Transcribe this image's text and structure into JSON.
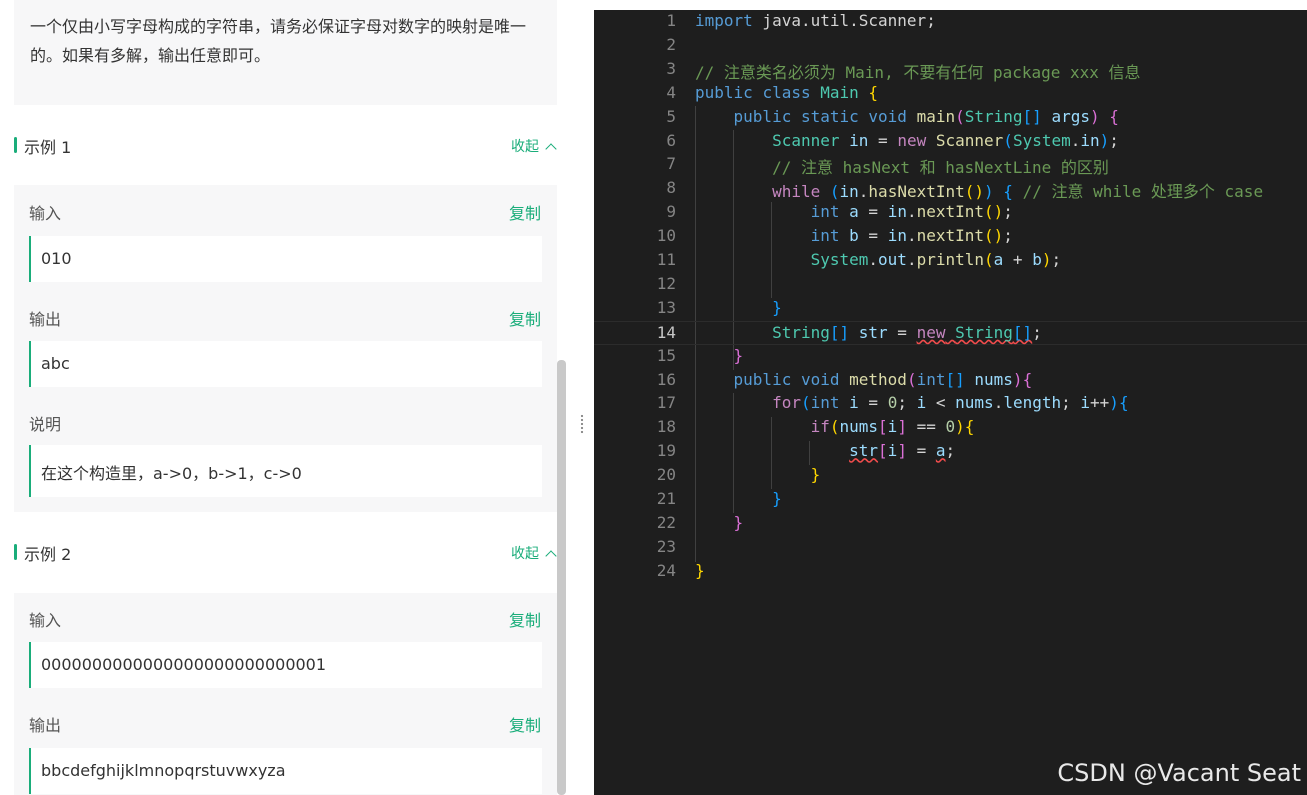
{
  "problem": {
    "description": "一个仅由小写字母构成的字符串，请务必保证字母对数字的映射是唯一的。如果有多解，输出任意即可。",
    "collapse_label": "收起",
    "copy_label": "复制",
    "examples": [
      {
        "title": "示例 1",
        "input_label": "输入",
        "input": "010",
        "output_label": "输出",
        "output": "abc",
        "explain_label": "说明",
        "explanation": "在这个构造里，a->0，b->1，c->0"
      },
      {
        "title": "示例 2",
        "input_label": "输入",
        "input": "0000000000000000000000000001",
        "output_label": "输出",
        "output": "bbcdefghijklmnopqrstuvwxyza"
      }
    ]
  },
  "editor": {
    "current_line": 14,
    "lines": [
      [
        [
          "k",
          "import"
        ],
        [
          "p",
          " java.util.Scanner;"
        ]
      ],
      [],
      [
        [
          "cm",
          "// 注意类名必须为 Main, 不要有任何 package xxx 信息"
        ]
      ],
      [
        [
          "k",
          "public"
        ],
        [
          "p",
          " "
        ],
        [
          "k",
          "class"
        ],
        [
          "p",
          " "
        ],
        [
          "t",
          "Main"
        ],
        [
          "p",
          " "
        ],
        [
          "b1",
          "{"
        ]
      ],
      [
        [
          "p",
          "    "
        ],
        [
          "k",
          "public"
        ],
        [
          "p",
          " "
        ],
        [
          "k",
          "static"
        ],
        [
          "p",
          " "
        ],
        [
          "k",
          "void"
        ],
        [
          "p",
          " "
        ],
        [
          "f",
          "main"
        ],
        [
          "b2",
          "("
        ],
        [
          "t",
          "String"
        ],
        [
          "b3",
          "[]"
        ],
        [
          "p",
          " "
        ],
        [
          "v",
          "args"
        ],
        [
          "b2",
          ")"
        ],
        [
          "p",
          " "
        ],
        [
          "b2",
          "{"
        ]
      ],
      [
        [
          "p",
          "        "
        ],
        [
          "t",
          "Scanner"
        ],
        [
          "p",
          " "
        ],
        [
          "v",
          "in"
        ],
        [
          "p",
          " = "
        ],
        [
          "c2",
          "new"
        ],
        [
          "p",
          " "
        ],
        [
          "f",
          "Scanner"
        ],
        [
          "b3",
          "("
        ],
        [
          "t",
          "System"
        ],
        [
          "p",
          "."
        ],
        [
          "v",
          "in"
        ],
        [
          "b3",
          ")"
        ],
        [
          "p",
          ";"
        ]
      ],
      [
        [
          "p",
          "        "
        ],
        [
          "cm",
          "// 注意 hasNext 和 hasNextLine 的区别"
        ]
      ],
      [
        [
          "p",
          "        "
        ],
        [
          "c2",
          "while"
        ],
        [
          "p",
          " "
        ],
        [
          "b3",
          "("
        ],
        [
          "v",
          "in"
        ],
        [
          "p",
          "."
        ],
        [
          "f",
          "hasNextInt"
        ],
        [
          "b1",
          "()"
        ],
        [
          "b3",
          ")"
        ],
        [
          "p",
          " "
        ],
        [
          "b3",
          "{"
        ],
        [
          "p",
          " "
        ],
        [
          "cm",
          "// 注意 while 处理多个 case"
        ]
      ],
      [
        [
          "p",
          "            "
        ],
        [
          "k",
          "int"
        ],
        [
          "p",
          " "
        ],
        [
          "v",
          "a"
        ],
        [
          "p",
          " = "
        ],
        [
          "v",
          "in"
        ],
        [
          "p",
          "."
        ],
        [
          "f",
          "nextInt"
        ],
        [
          "b1",
          "()"
        ],
        [
          "p",
          ";"
        ]
      ],
      [
        [
          "p",
          "            "
        ],
        [
          "k",
          "int"
        ],
        [
          "p",
          " "
        ],
        [
          "v",
          "b"
        ],
        [
          "p",
          " = "
        ],
        [
          "v",
          "in"
        ],
        [
          "p",
          "."
        ],
        [
          "f",
          "nextInt"
        ],
        [
          "b1",
          "()"
        ],
        [
          "p",
          ";"
        ]
      ],
      [
        [
          "p",
          "            "
        ],
        [
          "t",
          "System"
        ],
        [
          "p",
          "."
        ],
        [
          "v",
          "out"
        ],
        [
          "p",
          "."
        ],
        [
          "f",
          "println"
        ],
        [
          "b1",
          "("
        ],
        [
          "v",
          "a"
        ],
        [
          "p",
          " + "
        ],
        [
          "v",
          "b"
        ],
        [
          "b1",
          ")"
        ],
        [
          "p",
          ";"
        ]
      ],
      [],
      [
        [
          "p",
          "        "
        ],
        [
          "b3",
          "}"
        ]
      ],
      [
        [
          "p",
          "        "
        ],
        [
          "t",
          "String"
        ],
        [
          "b3",
          "[]"
        ],
        [
          "p",
          " "
        ],
        [
          "v",
          "str"
        ],
        [
          "p",
          " = "
        ],
        [
          "c2 err",
          "new"
        ],
        [
          "p err",
          " "
        ],
        [
          "t err",
          "String"
        ],
        [
          "b3 err",
          "[]"
        ],
        [
          "p",
          ";"
        ]
      ],
      [
        [
          "p",
          "    "
        ],
        [
          "b2",
          "}"
        ]
      ],
      [
        [
          "p",
          "    "
        ],
        [
          "k",
          "public"
        ],
        [
          "p",
          " "
        ],
        [
          "k",
          "void"
        ],
        [
          "p",
          " "
        ],
        [
          "f",
          "method"
        ],
        [
          "b2",
          "("
        ],
        [
          "k",
          "int"
        ],
        [
          "b3",
          "[]"
        ],
        [
          "p",
          " "
        ],
        [
          "v",
          "nums"
        ],
        [
          "b2",
          ")"
        ],
        [
          "b2",
          "{"
        ]
      ],
      [
        [
          "p",
          "        "
        ],
        [
          "c2",
          "for"
        ],
        [
          "b3",
          "("
        ],
        [
          "k",
          "int"
        ],
        [
          "p",
          " "
        ],
        [
          "v",
          "i"
        ],
        [
          "p",
          " = "
        ],
        [
          "n",
          "0"
        ],
        [
          "p",
          "; "
        ],
        [
          "v",
          "i"
        ],
        [
          "p",
          " < "
        ],
        [
          "v",
          "nums"
        ],
        [
          "p",
          "."
        ],
        [
          "v",
          "length"
        ],
        [
          "p",
          "; "
        ],
        [
          "v",
          "i"
        ],
        [
          "p",
          "++"
        ],
        [
          "b3",
          ")"
        ],
        [
          "b3",
          "{"
        ]
      ],
      [
        [
          "p",
          "            "
        ],
        [
          "c2",
          "if"
        ],
        [
          "b1",
          "("
        ],
        [
          "v",
          "nums"
        ],
        [
          "b2",
          "["
        ],
        [
          "v",
          "i"
        ],
        [
          "b2",
          "]"
        ],
        [
          "p",
          " == "
        ],
        [
          "n",
          "0"
        ],
        [
          "b1",
          ")"
        ],
        [
          "b1",
          "{"
        ]
      ],
      [
        [
          "p",
          "                "
        ],
        [
          "v err",
          "str"
        ],
        [
          "b2",
          "["
        ],
        [
          "v",
          "i"
        ],
        [
          "b2",
          "]"
        ],
        [
          "p",
          " = "
        ],
        [
          "v err",
          "a"
        ],
        [
          "p",
          ";"
        ]
      ],
      [
        [
          "p",
          "            "
        ],
        [
          "b1",
          "}"
        ]
      ],
      [
        [
          "p",
          "        "
        ],
        [
          "b3",
          "}"
        ]
      ],
      [
        [
          "p",
          "    "
        ],
        [
          "b2",
          "}"
        ]
      ],
      [],
      [
        [
          "b1",
          "}"
        ]
      ]
    ]
  },
  "watermark": "CSDN @Vacant Seat"
}
